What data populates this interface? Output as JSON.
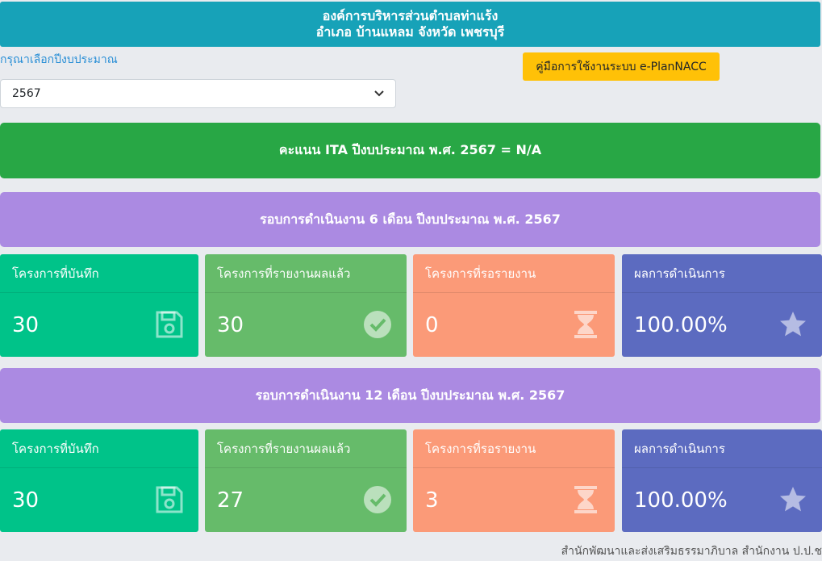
{
  "header": {
    "line1": "องค์การบริหารส่วนตำบลท่าแร้ง",
    "line2": "อำเภอ บ้านแหลม จังหวัด เพชรบุรี"
  },
  "year_select": {
    "label": "กรุณาเลือกปีงบประมาณ",
    "value": "2567"
  },
  "manual_button": "คู่มือการใช้งานระบบ e-PlanNACC",
  "ita": "คะแนน ITA ปีงบประมาณ พ.ศ. 2567 = N/A",
  "rounds": [
    {
      "title": "รอบการดำเนินงาน 6 เดือน ปีงบประมาณ พ.ศ. 2567",
      "cards": [
        {
          "title": "โครงการที่บันทึก",
          "value": "30",
          "icon": "save-icon"
        },
        {
          "title": "โครงการที่รายงานผลแล้ว",
          "value": "30",
          "icon": "check-circle-icon"
        },
        {
          "title": "โครงการที่รอรายงาน",
          "value": "0",
          "icon": "hourglass-icon"
        },
        {
          "title": "ผลการดำเนินการ",
          "value": "100.00%",
          "icon": "star-icon"
        }
      ]
    },
    {
      "title": "รอบการดำเนินงาน 12 เดือน ปีงบประมาณ พ.ศ. 2567",
      "cards": [
        {
          "title": "โครงการที่บันทึก",
          "value": "30",
          "icon": "save-icon"
        },
        {
          "title": "โครงการที่รายงานผลแล้ว",
          "value": "27",
          "icon": "check-circle-icon"
        },
        {
          "title": "โครงการที่รอรายงาน",
          "value": "3",
          "icon": "hourglass-icon"
        },
        {
          "title": "ผลการดำเนินการ",
          "value": "100.00%",
          "icon": "star-icon"
        }
      ]
    }
  ],
  "footer": "สำนักพัฒนาและส่งเสริมธรรมาภิบาล สำนักงาน ป.ป.ช",
  "colors": {
    "header": "#17a2b8",
    "ita": "#28a745",
    "round": "#ab8ae2",
    "card_saved": "#00c389",
    "card_reported": "#66bb6a",
    "card_pending": "#fb9a78",
    "card_result": "#5c6bc0",
    "manual_button": "#ffc107"
  }
}
